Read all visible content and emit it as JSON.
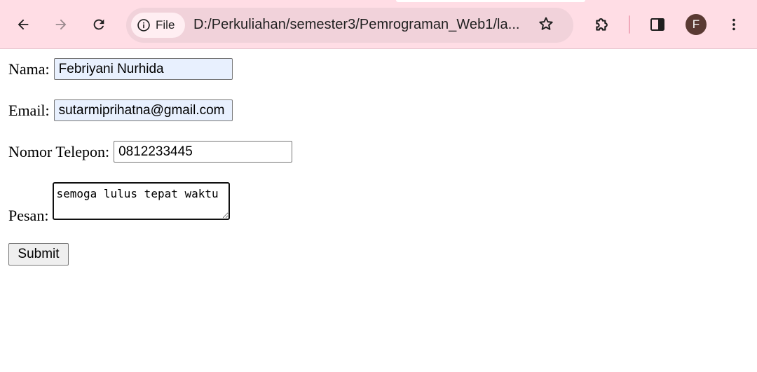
{
  "browser": {
    "site_chip_label": "File",
    "url": "D:/Perkuliahan/semester3/Pemrograman_Web1/la...",
    "profile_initial": "F",
    "theme_color": "#ffdde5"
  },
  "icons": {
    "back": "arrow-left-icon",
    "forward": "arrow-right-icon",
    "reload": "reload-icon",
    "info": "info-icon",
    "bookmark": "star-icon",
    "extensions": "puzzle-icon",
    "side_panel": "side-panel-icon",
    "menu": "three-dot-menu-icon"
  },
  "form": {
    "nama": {
      "label": "Nama:",
      "value": "Febriyani Nurhida"
    },
    "email": {
      "label": "Email:",
      "value": "sutarmiprihatna@gmail.com"
    },
    "telepon": {
      "label": "Nomor Telepon:",
      "value": "0812233445"
    },
    "pesan": {
      "label": "Pesan:",
      "value": "semoga lulus tepat waktu"
    },
    "submit_label": "Submit",
    "autofill_color": "#e8f0fe"
  }
}
